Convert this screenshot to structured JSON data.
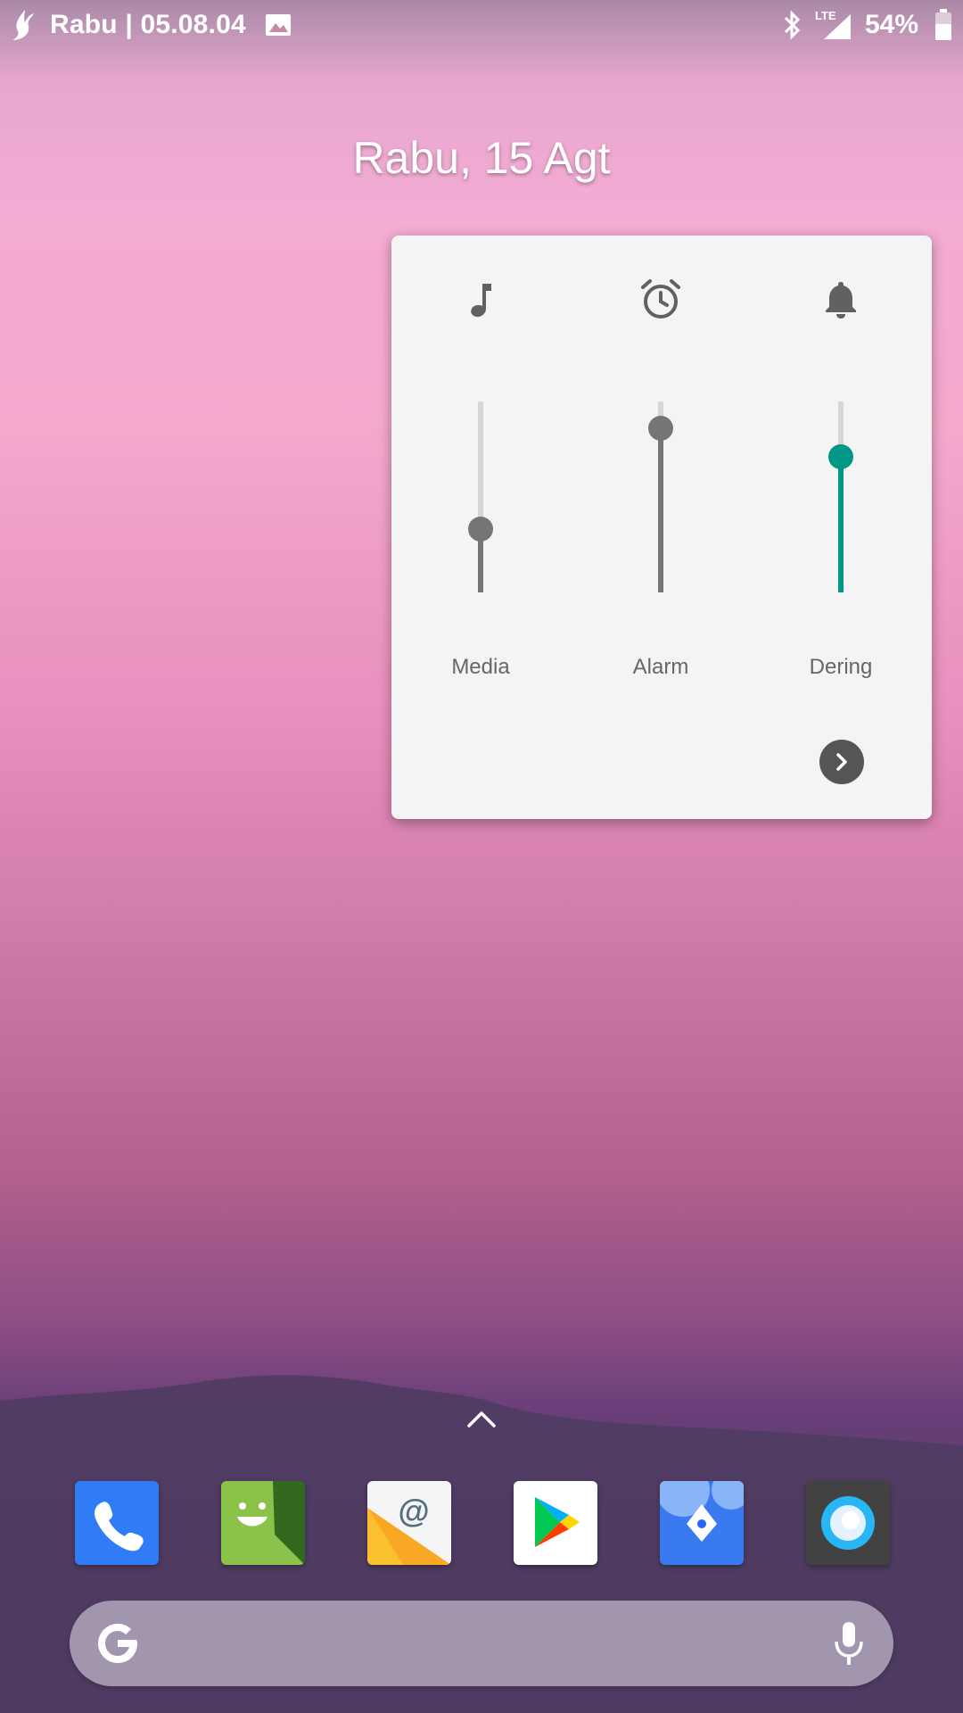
{
  "status_bar": {
    "left_text": "Rabu | 05.08.04",
    "network": "LTE",
    "battery_percent": "54%",
    "icons": [
      "flame-app-icon",
      "image-notification-icon",
      "bluetooth-icon",
      "lte-signal-icon",
      "battery-icon"
    ]
  },
  "home": {
    "date": "Rabu, 15 Agt"
  },
  "volume_panel": {
    "channels": [
      {
        "label": "Media",
        "icon": "music-note-icon",
        "level": 0.33
      },
      {
        "label": "Alarm",
        "icon": "alarm-clock-icon",
        "level": 0.86
      },
      {
        "label": "Dering",
        "icon": "bell-icon",
        "level": 0.71,
        "active": true
      }
    ],
    "accent_color": "#009688",
    "more_button_icon": "chevron-right-icon"
  },
  "dock": {
    "apps": [
      {
        "name": "Phone",
        "icon": "phone-icon"
      },
      {
        "name": "Messages",
        "icon": "messages-icon"
      },
      {
        "name": "Email",
        "icon": "email-icon"
      },
      {
        "name": "Play Store",
        "icon": "play-store-icon"
      },
      {
        "name": "Maps",
        "icon": "maps-icon"
      },
      {
        "name": "Assistant",
        "icon": "assistant-icon"
      }
    ]
  },
  "search_bar": {
    "left_icon": "google-g-icon",
    "right_icon": "microphone-icon"
  }
}
